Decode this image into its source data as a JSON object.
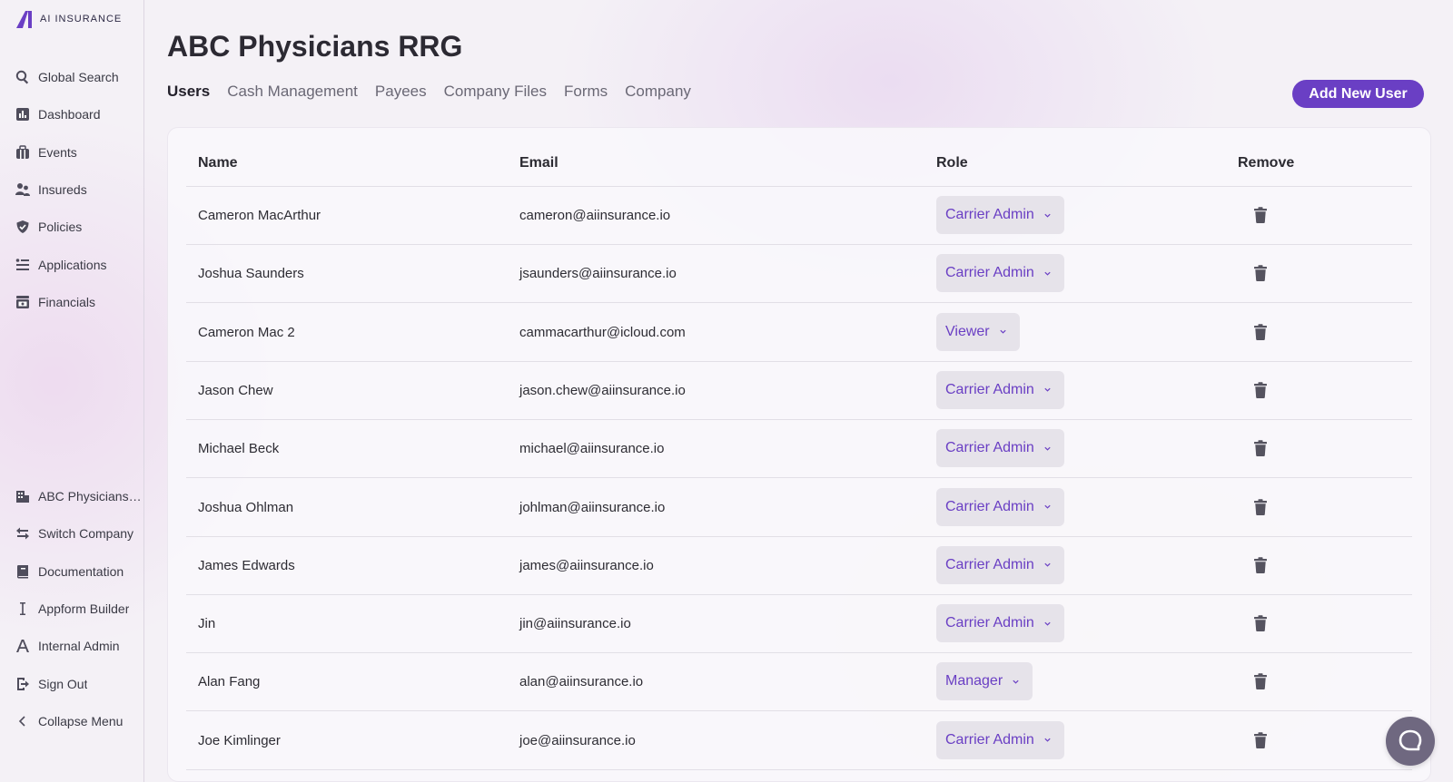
{
  "app": {
    "logo_text": "AI INSURANCE",
    "accent_color": "#6a3fc4"
  },
  "sidebar": {
    "top_items": [
      {
        "label": "Global Search",
        "icon": "search-icon"
      },
      {
        "label": "Dashboard",
        "icon": "chart-icon"
      },
      {
        "label": "Events",
        "icon": "calendar-icon"
      },
      {
        "label": "Insureds",
        "icon": "users-icon"
      },
      {
        "label": "Policies",
        "icon": "shield-icon"
      },
      {
        "label": "Applications",
        "icon": "list-icon"
      },
      {
        "label": "Financials",
        "icon": "cash-register-icon"
      }
    ],
    "bottom_items": [
      {
        "label": "ABC Physicians RRG",
        "icon": "building-icon"
      },
      {
        "label": "Switch Company",
        "icon": "switch-icon"
      },
      {
        "label": "Documentation",
        "icon": "book-icon"
      },
      {
        "label": "Appform Builder",
        "icon": "text-cursor-icon"
      },
      {
        "label": "Internal Admin",
        "icon": "letter-a-icon"
      },
      {
        "label": "Sign Out",
        "icon": "sign-out-icon"
      },
      {
        "label": "Collapse Menu",
        "icon": "chevron-left-icon"
      }
    ]
  },
  "main": {
    "title": "ABC Physicians RRG",
    "tabs": [
      {
        "label": "Users",
        "active": true
      },
      {
        "label": "Cash Management",
        "active": false
      },
      {
        "label": "Payees",
        "active": false
      },
      {
        "label": "Company Files",
        "active": false
      },
      {
        "label": "Forms",
        "active": false
      },
      {
        "label": "Company",
        "active": false
      }
    ],
    "add_button_label": "Add New User",
    "table": {
      "columns": [
        "Name",
        "Email",
        "Role",
        "Remove"
      ],
      "rows": [
        {
          "name": "Cameron MacArthur",
          "email": "cameron@aiinsurance.io",
          "role": "Carrier Admin"
        },
        {
          "name": "Joshua Saunders",
          "email": "jsaunders@aiinsurance.io",
          "role": "Carrier Admin"
        },
        {
          "name": "Cameron Mac 2",
          "email": "cammacarthur@icloud.com",
          "role": "Viewer"
        },
        {
          "name": "Jason Chew",
          "email": "jason.chew@aiinsurance.io",
          "role": "Carrier Admin"
        },
        {
          "name": "Michael Beck",
          "email": "michael@aiinsurance.io",
          "role": "Carrier Admin"
        },
        {
          "name": "Joshua Ohlman",
          "email": "johlman@aiinsurance.io",
          "role": "Carrier Admin"
        },
        {
          "name": "James Edwards",
          "email": "james@aiinsurance.io",
          "role": "Carrier Admin"
        },
        {
          "name": "Jin",
          "email": "jin@aiinsurance.io",
          "role": "Carrier Admin"
        },
        {
          "name": "Alan Fang",
          "email": "alan@aiinsurance.io",
          "role": "Manager"
        },
        {
          "name": "Joe Kimlinger",
          "email": "joe@aiinsurance.io",
          "role": "Carrier Admin"
        }
      ]
    }
  }
}
